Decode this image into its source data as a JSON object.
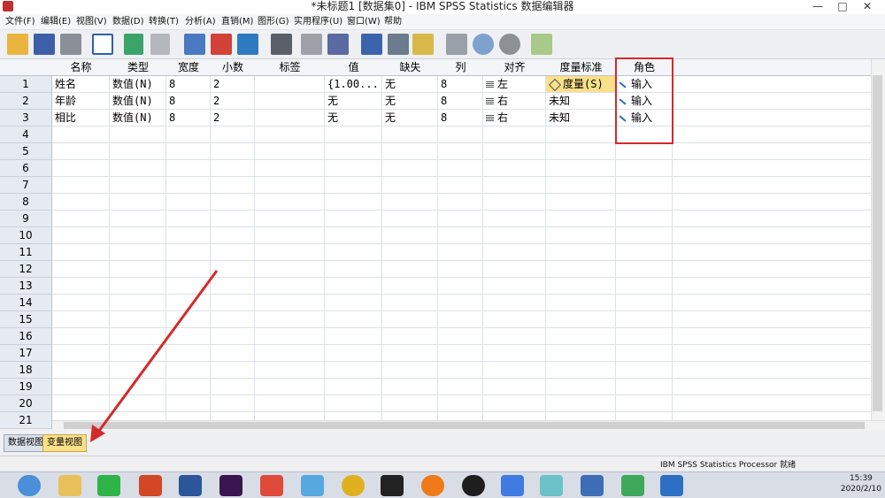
{
  "window": {
    "title": "*未标题1 [数据集0] - IBM SPSS Statistics 数据编辑器",
    "controls": [
      "—",
      "□",
      "✕"
    ]
  },
  "menu": [
    "文件(F)",
    "编辑(E)",
    "视图(V)",
    "数据(D)",
    "转换(T)",
    "分析(A)",
    "直销(M)",
    "图形(G)",
    "实用程序(U)",
    "窗口(W)",
    "帮助"
  ],
  "toolbar": [
    "open-icon",
    "save-icon",
    "print-icon",
    "dialog-recall-icon",
    "undo-icon",
    "redo-icon",
    "goto-case-icon",
    "goto-variable-icon",
    "variables-icon",
    "find-icon",
    "insert-cases-icon",
    "insert-variable-icon",
    "split-file-icon",
    "weight-cases-icon",
    "select-cases-icon",
    "value-labels-icon",
    "use-sets-icon",
    "show-all-icon",
    "spell-check-icon"
  ],
  "grid": {
    "columns": [
      "名称",
      "类型",
      "宽度",
      "小数",
      "标签",
      "值",
      "缺失",
      "列",
      "对齐",
      "度量标准",
      "角色"
    ],
    "rows": [
      {
        "num": "1",
        "name": "姓名",
        "type": "数值(N)",
        "width": "8",
        "decimals": "2",
        "label": "",
        "values": "{1.00...",
        "missing": "无",
        "columns": "8",
        "align": "左",
        "measure": "度量(S)",
        "role": "输入"
      },
      {
        "num": "2",
        "name": "年龄",
        "type": "数值(N)",
        "width": "8",
        "decimals": "2",
        "label": "",
        "values": "无",
        "missing": "无",
        "columns": "8",
        "align": "右",
        "measure": "未知",
        "role": "输入"
      },
      {
        "num": "3",
        "name": "相比",
        "type": "数值(N)",
        "width": "8",
        "decimals": "2",
        "label": "",
        "values": "无",
        "missing": "无",
        "columns": "8",
        "align": "右",
        "measure": "未知",
        "role": "输入"
      }
    ],
    "row_numbers": [
      "4",
      "5",
      "6",
      "7",
      "8",
      "9",
      "10",
      "11",
      "12",
      "13",
      "14",
      "15",
      "16",
      "17",
      "18",
      "19",
      "20",
      "21"
    ]
  },
  "tabs": {
    "data_view": "数据视图",
    "variable_view": "变量视图"
  },
  "status": "IBM SPSS Statistics Processor 就绪",
  "clock": {
    "time": "15:39",
    "date": "2020/2/10"
  },
  "colors": {
    "highlight_box": "#d42a2a",
    "selected_cell": "#fbe08a",
    "arrow": "#d42a2a"
  }
}
